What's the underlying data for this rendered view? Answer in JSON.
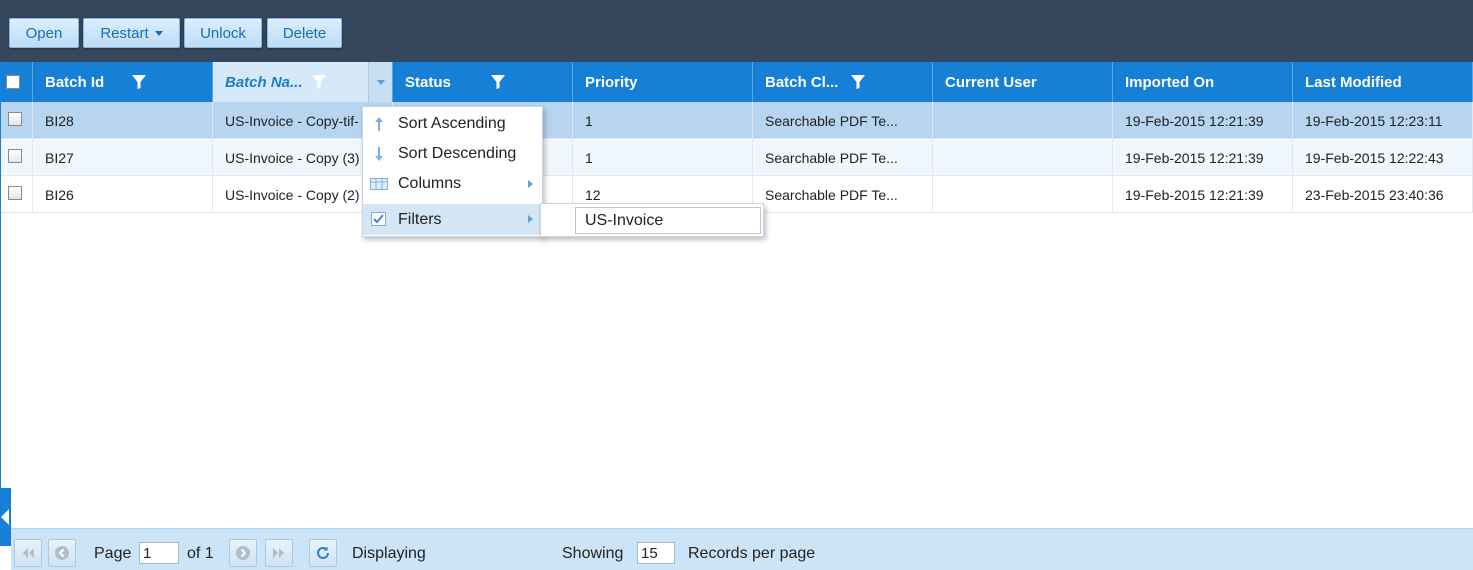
{
  "toolbar": {
    "open_label": "Open",
    "restart_label": "Restart",
    "unlock_label": "Unlock",
    "delete_label": "Delete"
  },
  "columns": {
    "batch_id": "Batch Id",
    "batch_name": "Batch Na...",
    "status": "Status",
    "priority": "Priority",
    "batch_class": "Batch Cl...",
    "current_user": "Current User",
    "imported_on": "Imported On",
    "last_modified": "Last Modified"
  },
  "rows": [
    {
      "batch_id": "BI28",
      "batch_name": "US-Invoice - Copy-tif-",
      "status": "",
      "priority": "1",
      "batch_class": "Searchable PDF Te...",
      "current_user": "",
      "imported_on": "19-Feb-2015 12:21:39",
      "last_modified": "19-Feb-2015 12:23:11"
    },
    {
      "batch_id": "BI27",
      "batch_name": "US-Invoice - Copy (3)",
      "status": "",
      "priority": "1",
      "batch_class": "Searchable PDF Te...",
      "current_user": "",
      "imported_on": "19-Feb-2015 12:21:39",
      "last_modified": "19-Feb-2015 12:22:43"
    },
    {
      "batch_id": "BI26",
      "batch_name": "US-Invoice - Copy (2)",
      "status": "",
      "priority": "12",
      "batch_class": "Searchable PDF Te...",
      "current_user": "",
      "imported_on": "19-Feb-2015 12:21:39",
      "last_modified": "23-Feb-2015 23:40:36"
    }
  ],
  "column_menu": {
    "sort_ascending": "Sort Ascending",
    "sort_descending": "Sort Descending",
    "columns": "Columns",
    "filters": "Filters"
  },
  "filter_value": "US-Invoice",
  "pager": {
    "page_label": "Page",
    "page_value": "1",
    "of_label": "of 1",
    "displaying": "Displaying",
    "showing_label": "Showing",
    "per_page_value": "15",
    "records_label": "Records per page"
  },
  "colors": {
    "toolbar_bg": "#34475d",
    "header_bg": "#1680d6",
    "selected_row": "#b7d5ef",
    "pager_bg": "#cce4f7"
  },
  "icons": [
    "funnel-icon",
    "sort-ascending-icon",
    "sort-descending-icon",
    "columns-icon",
    "filter-checkbox-icon",
    "first-page-icon",
    "prev-page-icon",
    "next-page-icon",
    "last-page-icon",
    "refresh-icon",
    "collapse-arrow-icon"
  ]
}
